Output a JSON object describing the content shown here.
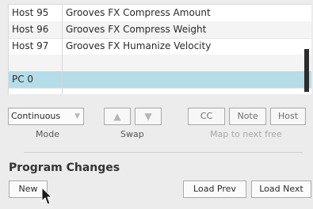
{
  "table": {
    "rows": [
      {
        "num": "Host 95",
        "name": "Grooves FX Compress Amount"
      },
      {
        "num": "Host 96",
        "name": "Grooves FX Compress Weight"
      },
      {
        "num": "Host 97",
        "name": "Grooves FX Humanize Velocity"
      },
      {
        "num": "",
        "name": ""
      },
      {
        "num": "PC 0",
        "name": ""
      }
    ]
  },
  "controls": {
    "mode_value": "Continuous",
    "mode_label": "Mode",
    "swap_label": "Swap",
    "up_arrow": "▲",
    "down_arrow": "▼",
    "cc_label": "CC",
    "note_label": "Note",
    "host_label": "Host",
    "map_label": "Map to next free"
  },
  "program_changes": {
    "heading": "Program Changes",
    "new_label": "New",
    "load_prev_label": "Load Prev",
    "load_next_label": "Load Next"
  },
  "colors": {
    "selected_row": "#b5dde9",
    "scroll_thumb": "#2c2c2c"
  }
}
